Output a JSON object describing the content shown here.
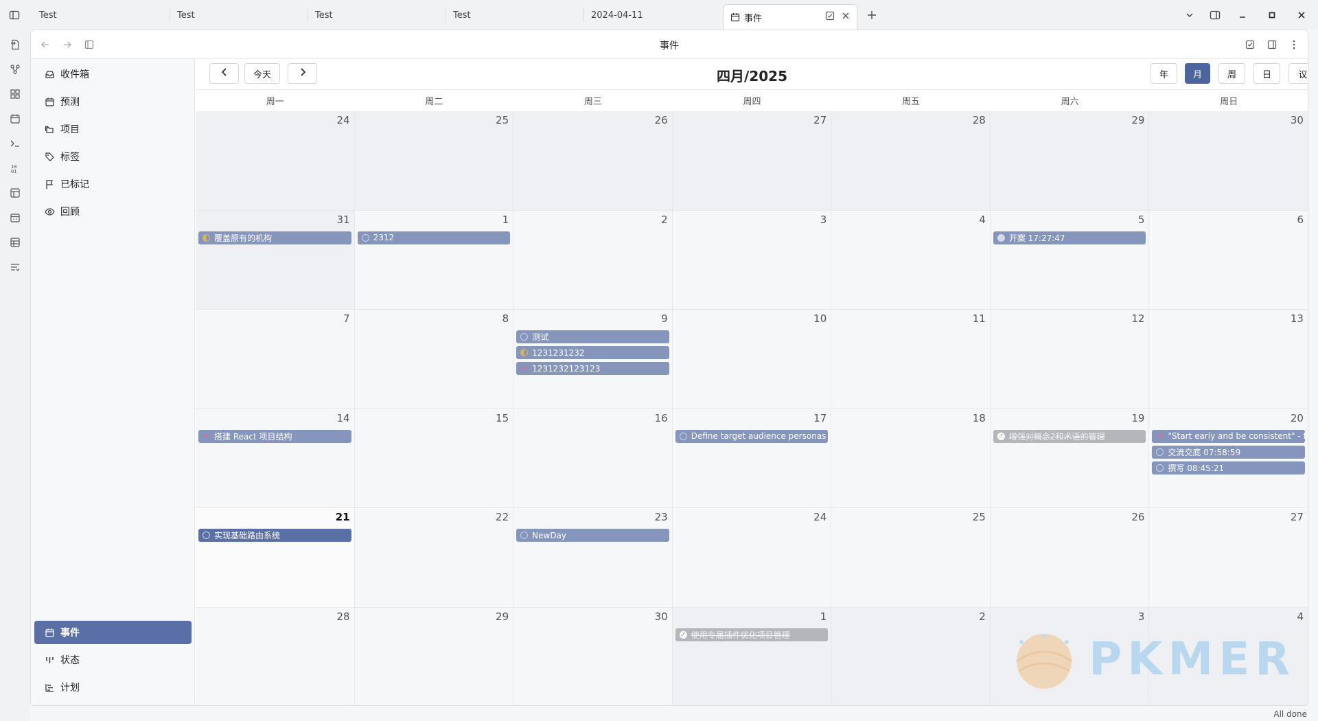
{
  "tabs": [
    {
      "label": "Test"
    },
    {
      "label": "Test"
    },
    {
      "label": "Test"
    },
    {
      "label": "Test"
    },
    {
      "label": "2024-04-11"
    },
    {
      "label": "事件",
      "active": true
    }
  ],
  "pane": {
    "title": "事件"
  },
  "sidebar": {
    "top_items": [
      {
        "label": "收件箱",
        "icon": "inbox-icon"
      },
      {
        "label": "预测",
        "icon": "calendar-icon"
      },
      {
        "label": "项目",
        "icon": "folders-icon"
      },
      {
        "label": "标签",
        "icon": "tag-icon"
      },
      {
        "label": "已标记",
        "icon": "flag-icon"
      },
      {
        "label": "回顾",
        "icon": "eye-icon"
      }
    ],
    "bottom_items": [
      {
        "label": "事件",
        "icon": "calendar-icon",
        "active": true
      },
      {
        "label": "状态",
        "icon": "kanban-icon"
      },
      {
        "label": "计划",
        "icon": "gantt-icon"
      }
    ]
  },
  "calendar": {
    "title": "四月/2025",
    "today_label": "今天",
    "views": [
      "年",
      "月",
      "周",
      "日",
      "议程"
    ],
    "active_view": "月",
    "weekdays": [
      "周一",
      "周二",
      "周三",
      "周四",
      "周五",
      "周六",
      "周日"
    ],
    "weeks": [
      [
        24,
        25,
        26,
        27,
        28,
        29,
        30
      ],
      [
        31,
        1,
        2,
        3,
        4,
        5,
        6
      ],
      [
        7,
        8,
        9,
        10,
        11,
        12,
        13
      ],
      [
        14,
        15,
        16,
        17,
        18,
        19,
        20
      ],
      [
        21,
        22,
        23,
        24,
        25,
        26,
        27
      ],
      [
        28,
        29,
        30,
        1,
        2,
        3,
        4
      ]
    ],
    "events": [
      {
        "week": 1,
        "day": 0,
        "slot": 0,
        "text": "覆盖原有的机构",
        "status": "half"
      },
      {
        "week": 1,
        "day": 1,
        "slot": 0,
        "text": "2312",
        "status": "todo"
      },
      {
        "week": 1,
        "day": 5,
        "slot": 0,
        "text": "开案 17:27:47",
        "status": "minus"
      },
      {
        "week": 2,
        "day": 2,
        "slot": 0,
        "text": "测试",
        "status": "todo"
      },
      {
        "week": 2,
        "day": 2,
        "slot": 1,
        "text": "1231231232",
        "status": "half"
      },
      {
        "week": 2,
        "day": 2,
        "slot": 2,
        "text": "1231232123123",
        "status": "cancel"
      },
      {
        "week": 3,
        "day": 0,
        "slot": 0,
        "text": "搭建 React 项目结构",
        "status": "cancel"
      },
      {
        "week": 3,
        "day": 3,
        "slot": 0,
        "text": "Define target audience personas",
        "status": "todo"
      },
      {
        "week": 3,
        "day": 5,
        "slot": 0,
        "text": "增强对概念2和术语的管理",
        "status": "done"
      },
      {
        "week": 3,
        "day": 6,
        "slot": 0,
        "text": "\"Start early and be consistent\" - finar",
        "status": "cancel"
      },
      {
        "week": 3,
        "day": 6,
        "slot": 1,
        "text": "交流交底 07:58:59",
        "status": "todo"
      },
      {
        "week": 3,
        "day": 6,
        "slot": 2,
        "text": "撰写 08:45:21",
        "status": "todo"
      },
      {
        "week": 4,
        "day": 0,
        "slot": 0,
        "text": "实现基础路由系统",
        "status": "todo",
        "dark": true
      },
      {
        "week": 4,
        "day": 2,
        "slot": 0,
        "text": "NewDay",
        "status": "todo"
      },
      {
        "week": 5,
        "day": 3,
        "slot": 0,
        "text": "使用专届插件优化项目管理",
        "status": "done"
      }
    ]
  },
  "watermark": {
    "text": "PKMER"
  },
  "status_bar": {
    "text": "All done"
  }
}
